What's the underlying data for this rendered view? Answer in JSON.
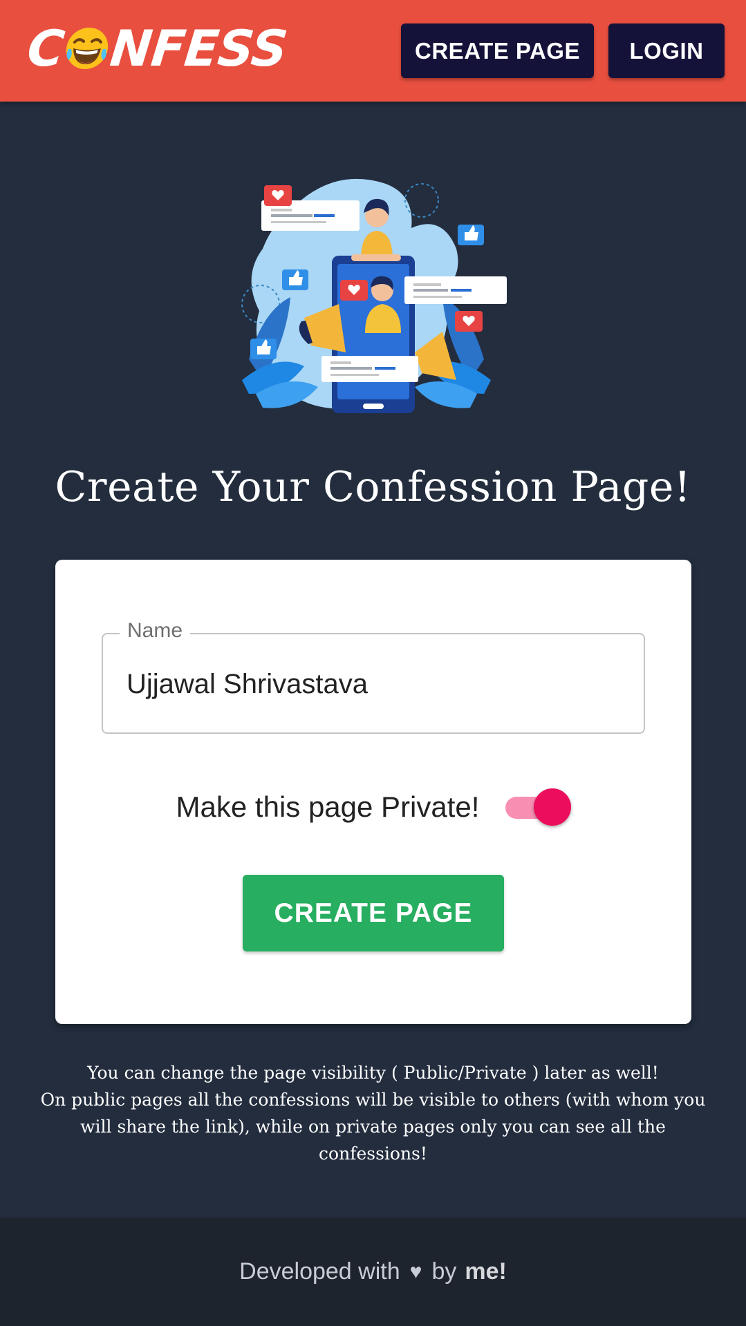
{
  "header": {
    "logo_text_start": "C",
    "logo_text_end": "NFESS",
    "create_page_label": "CREATE PAGE",
    "login_label": "LOGIN",
    "background_color": "#e84f3f",
    "button_color": "#15123a"
  },
  "hero": {
    "illustration": "social-media-confession-illustration"
  },
  "main": {
    "title": "Create Your Confession Page!"
  },
  "form": {
    "name_label": "Name",
    "name_value": "Ujjawal Shrivastava",
    "private_label": "Make this page Private!",
    "private_enabled": true,
    "submit_label": "CREATE PAGE",
    "submit_color": "#27ae60",
    "toggle_color": "#ec0d5c"
  },
  "info": {
    "line1": "You can change the page visibility ( Public/Private ) later as well!",
    "line2": "On public pages all the confessions will be visible to others (with whom you will share the link), while on private pages only you can see all the confessions!"
  },
  "footer": {
    "text_prefix": "Developed with",
    "heart": "♥",
    "text_by": "by",
    "author": "me!"
  }
}
